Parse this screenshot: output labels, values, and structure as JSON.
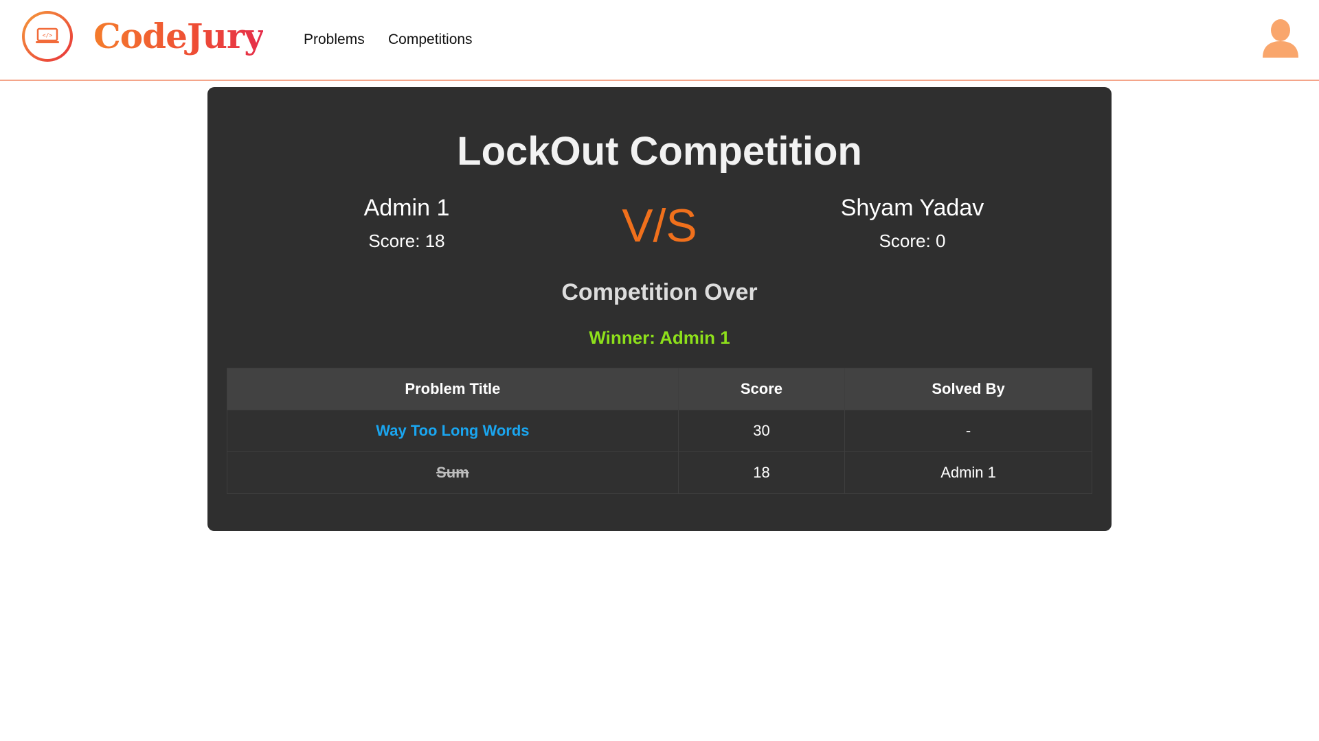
{
  "nav": {
    "brand": "CodeJury",
    "links": [
      "Problems",
      "Competitions"
    ]
  },
  "competition": {
    "title": "LockOut Competition",
    "vs_label": "V/S",
    "player1": {
      "name": "Admin 1",
      "score": "Score: 18"
    },
    "player2": {
      "name": "Shyam Yadav",
      "score": "Score: 0"
    },
    "status": "Competition Over",
    "winner": "Winner: Admin 1"
  },
  "table": {
    "headers": [
      "Problem Title",
      "Score",
      "Solved By"
    ],
    "rows": [
      {
        "title": "Way Too Long Words",
        "score": "30",
        "solved_by": "-"
      },
      {
        "title": "Sum",
        "score": "18",
        "solved_by": "Admin 1"
      }
    ]
  },
  "colors": {
    "accent": "#f0701c",
    "winner": "#8ee01b",
    "link": "#1aa6f0",
    "card": "#2f2f2f"
  },
  "icons": {
    "logo": "laptop-code-icon",
    "profile": "user-avatar-icon"
  }
}
